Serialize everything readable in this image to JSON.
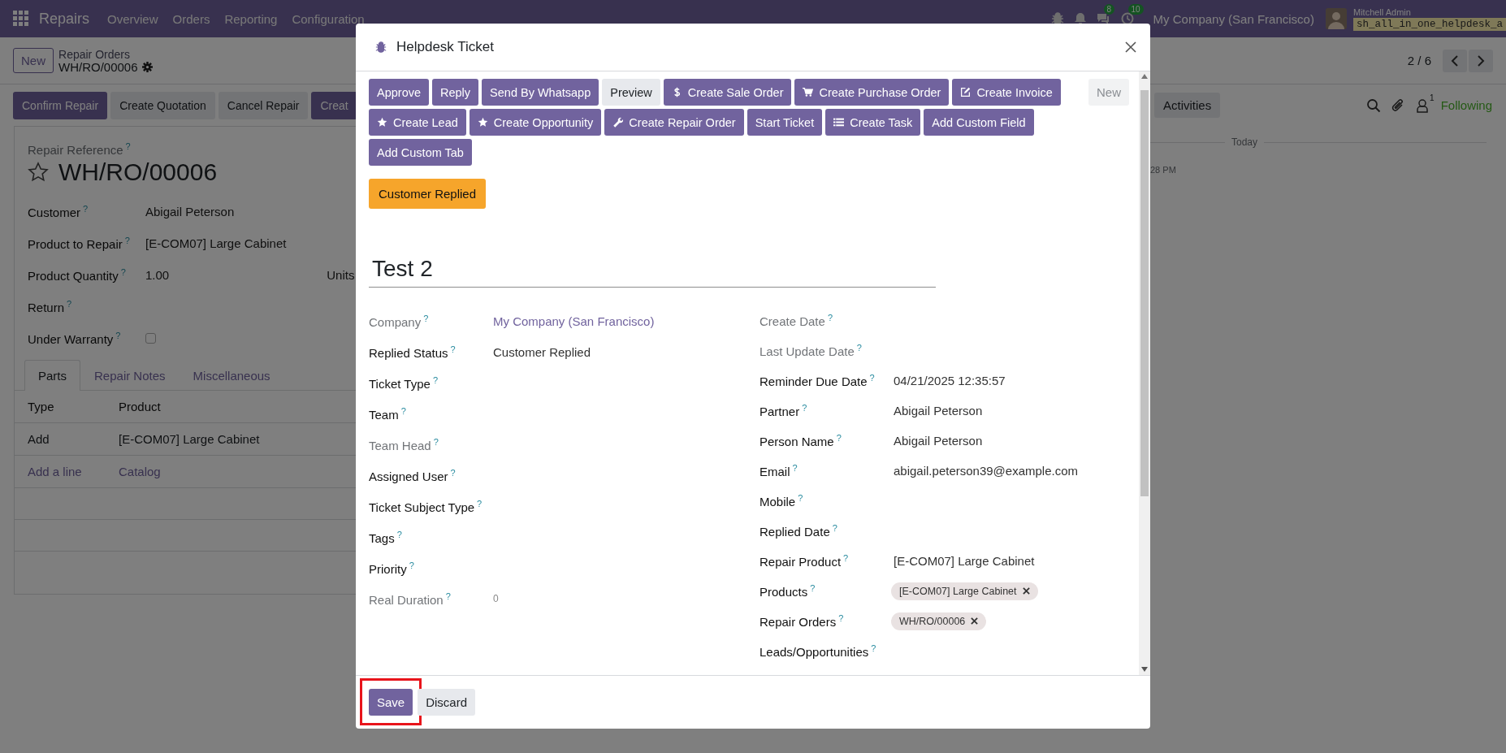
{
  "navbar": {
    "app_name": "Repairs",
    "menus": [
      "Overview",
      "Orders",
      "Reporting",
      "Configuration"
    ],
    "chat_badge": "8",
    "activity_badge": "10",
    "company": "My Company (San Francisco)",
    "user_name": "Mitchell Admin",
    "database": "sh_all_in_one_helpdesk_a"
  },
  "control_panel": {
    "new_button": "New",
    "breadcrumb_parent": "Repair Orders",
    "breadcrumb_current": "WH/RO/00006",
    "pager": "2 / 6"
  },
  "status_buttons": [
    {
      "label": "Confirm Repair",
      "kind": "primary"
    },
    {
      "label": "Create Quotation",
      "kind": "secondary"
    },
    {
      "label": "Cancel Repair",
      "kind": "secondary"
    },
    {
      "label": "Creat",
      "kind": "primary"
    }
  ],
  "form": {
    "reference_label": "Repair Reference",
    "reference_help": "?",
    "reference": "WH/RO/00006",
    "starred": false,
    "fields": [
      {
        "label": "Customer",
        "help": "?",
        "kind": "text",
        "value": "Abigail Peterson"
      },
      {
        "label": "Product to Repair",
        "help": "?",
        "kind": "text",
        "value": "[E-COM07] Large Cabinet"
      },
      {
        "label": "Product Quantity",
        "help": "?",
        "kind": "quantity",
        "value": "1.00",
        "unit": "Units"
      },
      {
        "label": "Return",
        "help": "?",
        "kind": "text"
      },
      {
        "label": "Under Warranty",
        "help": "?",
        "kind": "checkbox",
        "checked": false
      }
    ],
    "tabs": [
      {
        "label": "Parts",
        "selected": true
      },
      {
        "label": "Repair Notes",
        "selected": false
      },
      {
        "label": "Miscellaneous",
        "selected": false
      }
    ],
    "table": {
      "columns": [
        "Type",
        "Product"
      ],
      "rows": [
        [
          "Add",
          "[E-COM07] Large Cabinet"
        ]
      ],
      "add_line": "Add a line",
      "catalog": "Catalog"
    }
  },
  "chatter": {
    "activities": "Activities",
    "followers_count": "1",
    "following": "Following",
    "date_divider": "Today",
    "message_time": "28 PM"
  },
  "dialog": {
    "title": "Helpdesk Ticket",
    "new_button": "New",
    "status_badge": "Customer Replied",
    "name": "Test 2",
    "header_buttons": [
      {
        "label": "Approve",
        "kind": "primary"
      },
      {
        "label": "Reply",
        "kind": "primary"
      },
      {
        "label": "Send By Whatsapp",
        "kind": "primary"
      },
      {
        "label": "Preview",
        "kind": "secondary"
      },
      {
        "label": "Create Sale Order",
        "kind": "primary"
      },
      {
        "label": "Create Purchase Order",
        "kind": "primary"
      },
      {
        "label": "Create Invoice",
        "kind": "primary"
      },
      {
        "label": "Create Lead",
        "kind": "primary"
      },
      {
        "label": "Create Opportunity",
        "kind": "primary"
      },
      {
        "label": "Create Repair Order",
        "kind": "primary"
      },
      {
        "label": "Start Ticket",
        "kind": "primary"
      },
      {
        "label": "Create Task",
        "kind": "primary"
      },
      {
        "label": "Add Custom Field",
        "kind": "primary"
      },
      {
        "label": "Add Custom Tab",
        "kind": "primary"
      }
    ],
    "left_fields": [
      {
        "label": "Company",
        "help": "?",
        "readonly": true,
        "kind": "link",
        "value": "My Company (San Francisco)"
      },
      {
        "label": "Replied Status",
        "help": "?",
        "readonly": false,
        "kind": "text",
        "value": "Customer Replied"
      },
      {
        "label": "Ticket Type",
        "help": "?",
        "readonly": false,
        "kind": "text"
      },
      {
        "label": "Team",
        "help": "?",
        "readonly": false,
        "kind": "text"
      },
      {
        "label": "Team Head",
        "help": "?",
        "readonly": true,
        "kind": "text"
      },
      {
        "label": "Assigned User",
        "help": "?",
        "readonly": false,
        "kind": "text"
      },
      {
        "label": "Ticket Subject Type",
        "help": "?",
        "readonly": false,
        "kind": "text"
      },
      {
        "label": "Tags",
        "help": "?",
        "readonly": false,
        "kind": "text"
      },
      {
        "label": "Priority",
        "help": "?",
        "readonly": false,
        "kind": "text"
      },
      {
        "label": "Real Duration",
        "help": "?",
        "readonly": true,
        "kind": "text",
        "value": "0"
      }
    ],
    "right_fields": [
      {
        "label": "Create Date",
        "help": "?",
        "readonly": true,
        "kind": "text"
      },
      {
        "label": "Last Update Date",
        "help": "?",
        "readonly": true,
        "kind": "text"
      },
      {
        "label": "Reminder Due Date",
        "help": "?",
        "readonly": false,
        "kind": "text",
        "value": "04/21/2025 12:35:57"
      },
      {
        "label": "Partner",
        "help": "?",
        "readonly": false,
        "kind": "text",
        "value": "Abigail Peterson"
      },
      {
        "label": "Person Name",
        "help": "?",
        "readonly": false,
        "kind": "text",
        "value": "Abigail Peterson"
      },
      {
        "label": "Email",
        "help": "?",
        "readonly": false,
        "kind": "text",
        "value": "abigail.peterson39@example.com"
      },
      {
        "label": "Mobile",
        "help": "?",
        "readonly": false,
        "kind": "text"
      },
      {
        "label": "Replied Date",
        "help": "?",
        "readonly": false,
        "kind": "text"
      },
      {
        "label": "Repair Product",
        "help": "?",
        "readonly": false,
        "kind": "text",
        "value": "[E-COM07] Large Cabinet"
      },
      {
        "label": "Products",
        "help": "?",
        "readonly": false,
        "kind": "tags",
        "tags": [
          "[E-COM07] Large Cabinet"
        ]
      },
      {
        "label": "Repair Orders",
        "help": "?",
        "readonly": false,
        "kind": "tags",
        "tags": [
          "WH/RO/00006"
        ]
      },
      {
        "label": "Leads/Opportunities",
        "help": "?",
        "readonly": false,
        "kind": "text"
      }
    ],
    "footer_buttons": [
      {
        "label": "Save",
        "kind": "primary",
        "highlighted": true
      },
      {
        "label": "Discard",
        "kind": "secondary",
        "highlighted": false
      }
    ]
  }
}
